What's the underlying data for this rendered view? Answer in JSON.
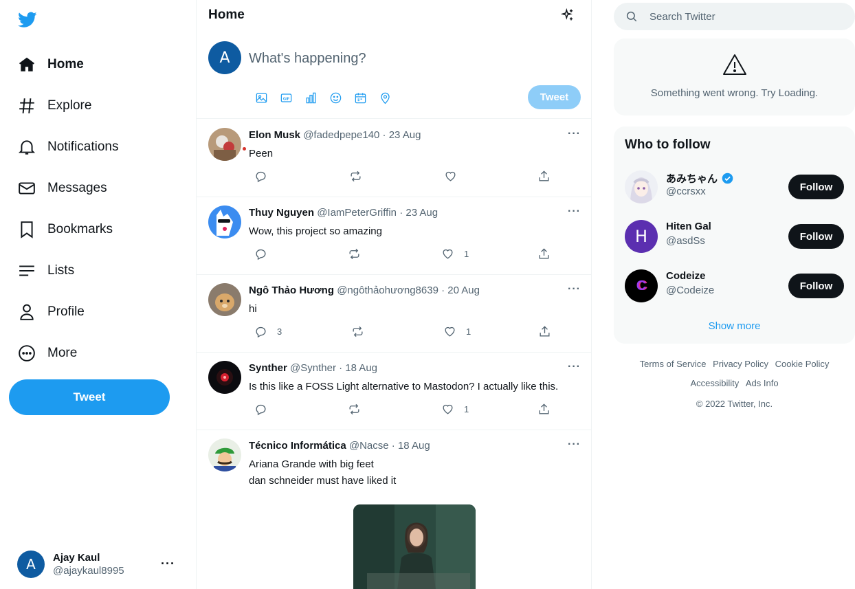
{
  "colors": {
    "brand": "#1d9bf0",
    "brand_disabled": "#8ecdf8",
    "text": "#0f1419",
    "muted": "#536471",
    "avatar": "#0e5ba1",
    "hiten": "#5b2fb0"
  },
  "nav": {
    "items": [
      {
        "label": "Home",
        "icon": "home-icon"
      },
      {
        "label": "Explore",
        "icon": "hashtag-icon"
      },
      {
        "label": "Notifications",
        "icon": "bell-icon"
      },
      {
        "label": "Messages",
        "icon": "envelope-icon"
      },
      {
        "label": "Bookmarks",
        "icon": "bookmark-icon"
      },
      {
        "label": "Lists",
        "icon": "lists-icon"
      },
      {
        "label": "Profile",
        "icon": "person-icon"
      },
      {
        "label": "More",
        "icon": "more-circle-icon"
      }
    ],
    "tweet_button": "Tweet"
  },
  "account": {
    "initial": "A",
    "display_name": "Ajay Kaul",
    "handle": "@ajaykaul8995",
    "menu": "···"
  },
  "header": {
    "title": "Home"
  },
  "compose": {
    "initial": "A",
    "placeholder": "What's happening?",
    "tweet_button": "Tweet"
  },
  "tweets": [
    {
      "name": "Elon Musk",
      "handle": "@fadedpepe140",
      "date": "· 23 Aug",
      "lines": [
        "Peen"
      ],
      "replies": "",
      "likes": "",
      "more": "···"
    },
    {
      "name": "Thuy Nguyen",
      "handle": "@IamPeterGriffin",
      "date": "· 23 Aug",
      "lines": [
        "Wow, this project so amazing"
      ],
      "replies": "",
      "likes": "1",
      "more": "···"
    },
    {
      "name": "Ngô Thảo Hương",
      "handle": "@ngôthảohương8639",
      "date": "· 20 Aug",
      "lines": [
        "hi"
      ],
      "replies": "3",
      "likes": "1",
      "more": "···"
    },
    {
      "name": "Synther",
      "handle": "@Synther",
      "date": "· 18 Aug",
      "lines": [
        "Is this like a FOSS Light alternative to Mastodon? I actually like this."
      ],
      "replies": "",
      "likes": "1",
      "more": "···"
    },
    {
      "name": "Técnico Informática",
      "handle": "@Nacse",
      "date": "· 18 Aug",
      "lines": [
        "Ariana Grande with big feet",
        "dan schneider must have liked it"
      ],
      "replies": "",
      "likes": "",
      "more": "···"
    }
  ],
  "search": {
    "placeholder": "Search Twitter"
  },
  "error": {
    "message": "Something went wrong. Try Loading."
  },
  "who_to_follow": {
    "title": "Who to follow",
    "users": [
      {
        "name": "あみちゃん",
        "handle": "@ccrsxx",
        "verified": true,
        "button": "Follow"
      },
      {
        "name": "Hiten Gal",
        "handle": "@asdSs",
        "initial": "H",
        "button": "Follow"
      },
      {
        "name": "Codeize",
        "handle": "@Codeize",
        "initial": "C",
        "button": "Follow"
      }
    ],
    "show_more": "Show more"
  },
  "footer": {
    "links": [
      "Terms of Service",
      "Privacy Policy",
      "Cookie Policy",
      "Accessibility",
      "Ads Info"
    ],
    "copyright": "© 2022 Twitter, Inc."
  }
}
